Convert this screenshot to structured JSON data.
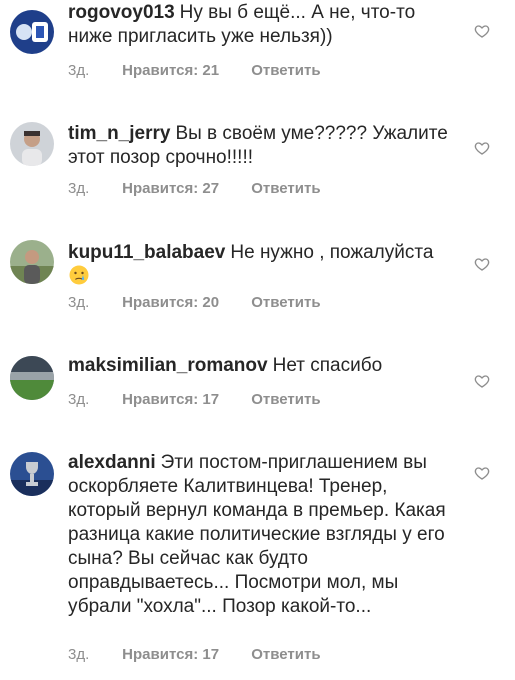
{
  "comments": [
    {
      "username": "rogovoy013",
      "text": "Ну вы б ещё... А не, что-то ниже пригласить уже нельзя))",
      "time": "3д.",
      "likes": "Нравится: 21",
      "reply": "Ответить",
      "avatar_icon": "avatar-blue-jersey",
      "heart_icon": "heart-outline-icon"
    },
    {
      "username": "tim_n_jerry",
      "text": "Вы в своём уме????? Ужалите этот позор срочно!!!!!",
      "time": "3д.",
      "likes": "Нравится: 27",
      "reply": "Ответить",
      "avatar_icon": "avatar-person-portrait",
      "heart_icon": "heart-outline-icon"
    },
    {
      "username": "kupu11_balabaev",
      "text": "Не нужно , пожалуйста",
      "emoji": "crying-face-emoji",
      "time": "3д.",
      "likes": "Нравится: 20",
      "reply": "Ответить",
      "avatar_icon": "avatar-person-outdoor",
      "heart_icon": "heart-outline-icon"
    },
    {
      "username": "maksimilian_romanov",
      "text": "Нет спасибо",
      "time": "3д.",
      "likes": "Нравится: 17",
      "reply": "Ответить",
      "avatar_icon": "avatar-stadium",
      "heart_icon": "heart-outline-icon"
    },
    {
      "username": "alexdanni",
      "text": "Эти постом-приглашением вы оскорбляете Калитвинцева! Тренер, который вернул команда в премьер. Какая разница какие политические взгляды у его сына? Вы сейчас как будто оправдываетесь... Посмотри мол, мы убрали \"хохла\"... Позор какой-то...",
      "time": "3д.",
      "likes": "Нравится: 17",
      "reply": "Ответить",
      "avatar_icon": "avatar-trophy",
      "heart_icon": "heart-outline-icon"
    }
  ],
  "colors": {
    "text": "#262626",
    "meta": "#8e8e8e",
    "heart_stroke": "#8e8e8e"
  }
}
